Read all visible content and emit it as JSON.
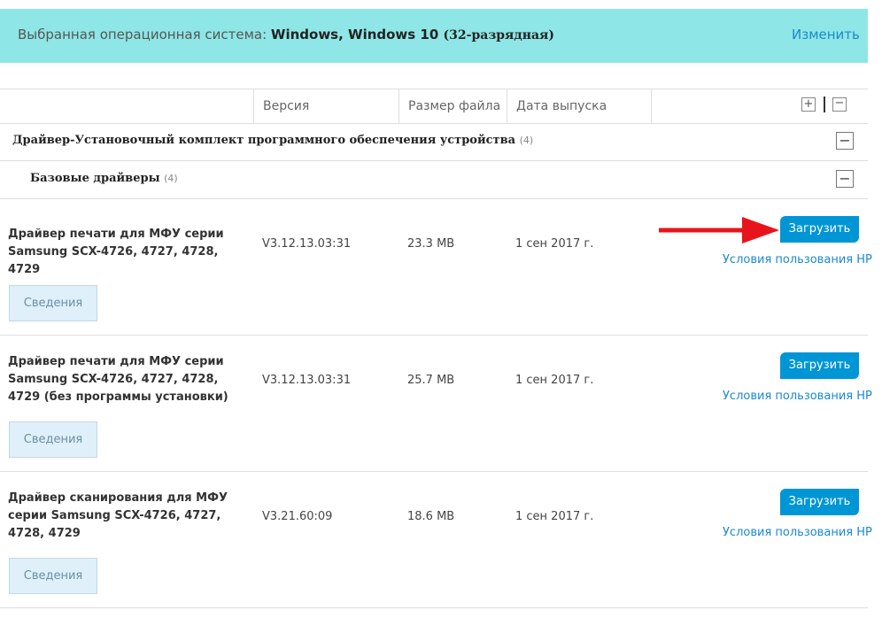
{
  "os_banner": {
    "prefix": "Выбранная операционная система: ",
    "os_name": "Windows, Windows 10 ",
    "os_bits": "(32-разрядная)",
    "change_link": "Изменить"
  },
  "table_header": {
    "version": "Версия",
    "size": "Размер файла",
    "date": "Дата выпуска",
    "expand_all": "+",
    "collapse_all": "−"
  },
  "groups": [
    {
      "title": "Драйвер-Установочный комплект программного обеспечения устройства",
      "count": "(4)",
      "toggle": "−"
    },
    {
      "title": "Базовые драйверы",
      "count": "(4)",
      "toggle": "−"
    }
  ],
  "drivers": [
    {
      "name": "Драйвер печати для МФУ серии Samsung SCX-4726, 4727, 4728, 4729",
      "version": "V3.12.13.03:31",
      "size": "23.3 MB",
      "date": "1 сен 2017 г.",
      "download_label": "Загрузить",
      "terms_label": "Условия пользования HP",
      "details_label": "Сведения"
    },
    {
      "name": "Драйвер печати для МФУ серии Samsung SCX-4726, 4727, 4728, 4729 (без программы установки)",
      "version": "V3.12.13.03:31",
      "size": "25.7 MB",
      "date": "1 сен 2017 г.",
      "download_label": "Загрузить",
      "terms_label": "Условия пользования HP",
      "details_label": "Сведения"
    },
    {
      "name": "Драйвер сканирования для МФУ серии Samsung SCX-4726, 4727, 4728, 4729",
      "version": "V3.21.60:09",
      "size": "18.6 MB",
      "date": "1 сен 2017 г.",
      "download_label": "Загрузить",
      "terms_label": "Условия пользования HP",
      "details_label": "Сведения"
    }
  ],
  "colors": {
    "banner": "#8ee6e6",
    "accent": "#0096d6",
    "link": "#1a8acb",
    "arrow": "#e8141b"
  }
}
